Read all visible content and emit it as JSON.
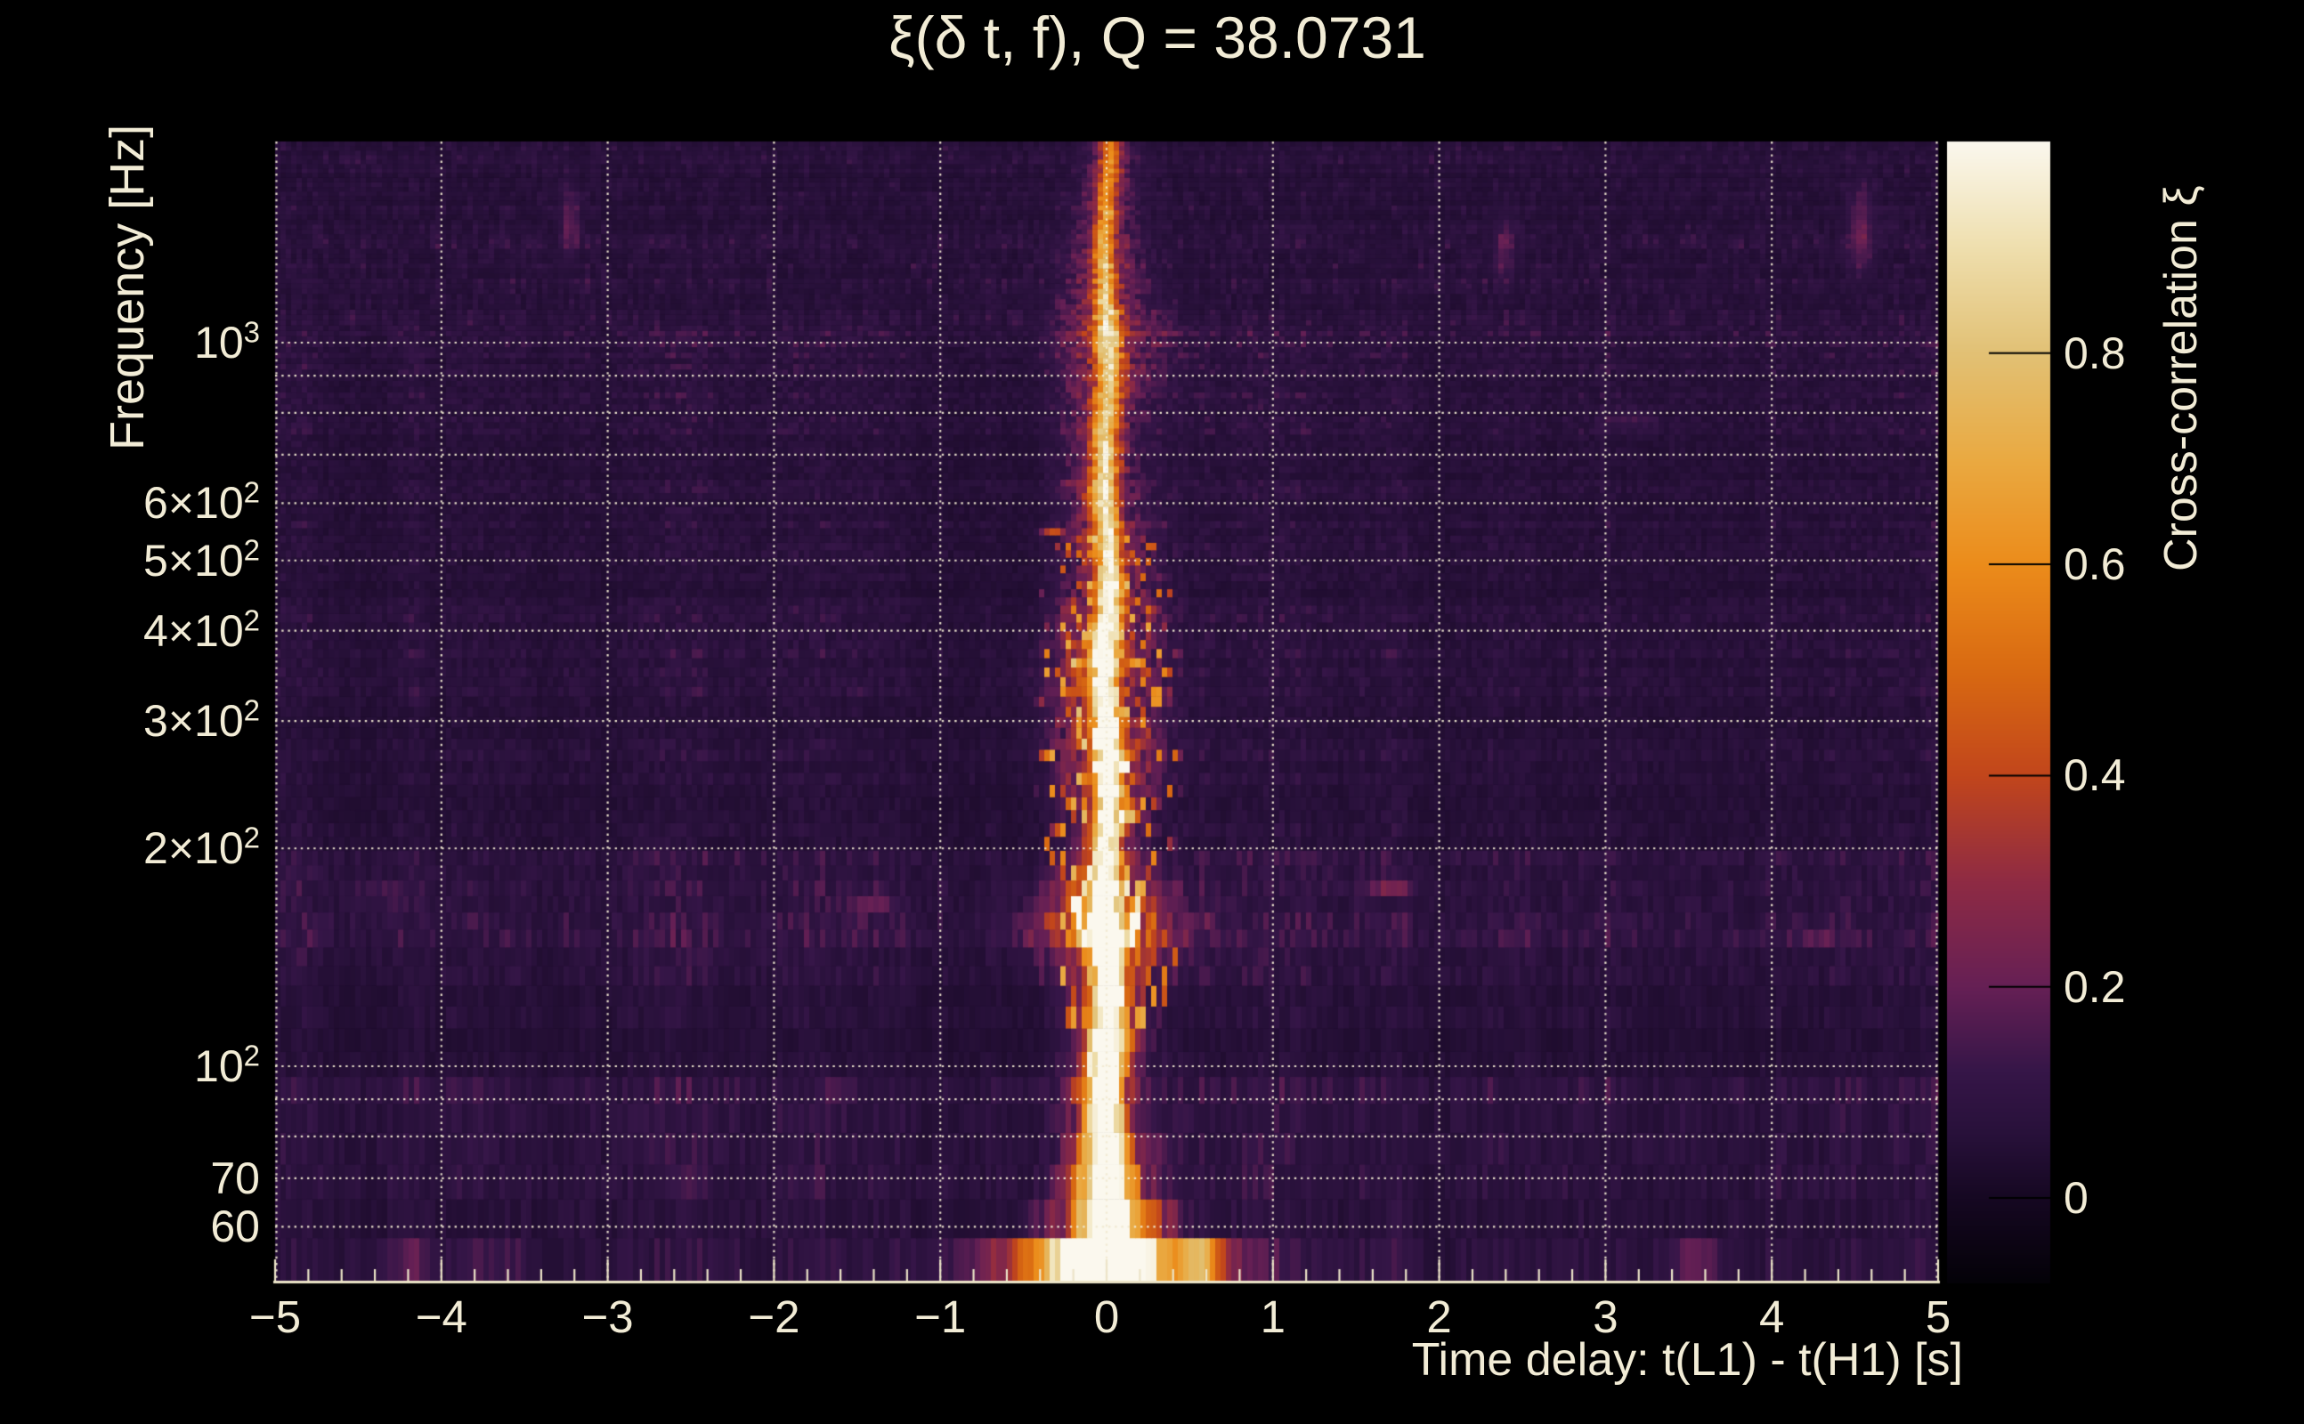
{
  "title": "ξ(δ t, f), Q = 38.0731",
  "chart_data": {
    "type": "heatmap",
    "title": "ξ(δ t, f), Q = 38.0731",
    "q_value": 38.0731,
    "xlabel": "Time delay: t(L1) - t(H1) [s]",
    "ylabel": "Frequency [Hz]",
    "colorbar_label": "Cross-correlation ξ",
    "x_range": [
      -5,
      5
    ],
    "x_minor_step": 0.2,
    "x_ticks": [
      {
        "label": "−5",
        "value": -5
      },
      {
        "label": "−4",
        "value": -4
      },
      {
        "label": "−3",
        "value": -3
      },
      {
        "label": "−2",
        "value": -2
      },
      {
        "label": "−1",
        "value": -1
      },
      {
        "label": "0",
        "value": 0
      },
      {
        "label": "1",
        "value": 1
      },
      {
        "label": "2",
        "value": 2
      },
      {
        "label": "3",
        "value": 3
      },
      {
        "label": "4",
        "value": 4
      },
      {
        "label": "5",
        "value": 5
      }
    ],
    "y_scale": "log",
    "y_range_hz": [
      50.4,
      1897
    ],
    "y_ticks": [
      {
        "base": "10",
        "exp": "3",
        "hz": 1000
      },
      {
        "base": "6×10",
        "exp": "2",
        "hz": 600
      },
      {
        "base": "5×10",
        "exp": "2",
        "hz": 500
      },
      {
        "base": "4×10",
        "exp": "2",
        "hz": 400
      },
      {
        "base": "3×10",
        "exp": "2",
        "hz": 300
      },
      {
        "base": "2×10",
        "exp": "2",
        "hz": 200
      },
      {
        "base": "10",
        "exp": "2",
        "hz": 100
      },
      {
        "base": "70",
        "exp": "",
        "hz": 70
      },
      {
        "base": "60",
        "exp": "",
        "hz": 60
      }
    ],
    "y_gridlines_hz": [
      60,
      70,
      80,
      90,
      100,
      200,
      300,
      400,
      500,
      600,
      700,
      800,
      900,
      1000
    ],
    "grid": true,
    "z_range": [
      -0.08,
      1.0
    ],
    "colorbar_position": "right",
    "colorbar_ticks": [
      {
        "label": "0.8",
        "value": 0.8
      },
      {
        "label": "0.6",
        "value": 0.6
      },
      {
        "label": "0.4",
        "value": 0.4
      },
      {
        "label": "0.2",
        "value": 0.2
      },
      {
        "label": "0",
        "value": 0
      }
    ],
    "colormap_stops": [
      [
        -0.08,
        4,
        2,
        8
      ],
      [
        0.0,
        22,
        8,
        34
      ],
      [
        0.06,
        40,
        17,
        58
      ],
      [
        0.12,
        54,
        22,
        72
      ],
      [
        0.2,
        102,
        32,
        85
      ],
      [
        0.3,
        143,
        43,
        68
      ],
      [
        0.4,
        194,
        70,
        28
      ],
      [
        0.5,
        217,
        106,
        18
      ],
      [
        0.6,
        236,
        140,
        27
      ],
      [
        0.7,
        234,
        170,
        66
      ],
      [
        0.8,
        226,
        193,
        117
      ],
      [
        0.9,
        239,
        223,
        174
      ],
      [
        1.0,
        251,
        248,
        238
      ]
    ],
    "main_feature": "bright cross-correlation ridge at time delay ≈ 0 s spanning 50–1900 Hz, strongest (ξ→1) below ~200 Hz with a white maximum near 55–60 Hz and ~100 Hz",
    "ridge_center_s": 0,
    "ridge_profile": [
      {
        "f": 50,
        "core": 1.02,
        "cw": 14,
        "glow": 0.95,
        "gw": 60
      },
      {
        "f": 57,
        "core": 1.03,
        "cw": 16,
        "glow": 0.9,
        "gw": 75
      },
      {
        "f": 66,
        "core": 1.0,
        "cw": 12,
        "glow": 0.75,
        "gw": 48
      },
      {
        "f": 78,
        "core": 1.0,
        "cw": 10,
        "glow": 0.6,
        "gw": 38
      },
      {
        "f": 92,
        "core": 0.95,
        "cw": 9,
        "glow": 0.55,
        "gw": 34
      },
      {
        "f": 103,
        "core": 1.0,
        "cw": 10,
        "glow": 0.65,
        "gw": 40
      },
      {
        "f": 118,
        "core": 0.92,
        "cw": 9,
        "glow": 0.5,
        "gw": 34
      },
      {
        "f": 135,
        "core": 0.9,
        "cw": 9,
        "glow": 0.55,
        "gw": 46
      },
      {
        "f": 152,
        "core": 0.93,
        "cw": 10,
        "glow": 0.68,
        "gw": 78
      },
      {
        "f": 168,
        "core": 0.92,
        "cw": 9,
        "glow": 0.62,
        "gw": 66
      },
      {
        "f": 188,
        "core": 0.86,
        "cw": 8,
        "glow": 0.5,
        "gw": 42
      },
      {
        "f": 210,
        "core": 0.82,
        "cw": 8,
        "glow": 0.45,
        "gw": 34
      },
      {
        "f": 240,
        "core": 0.82,
        "cw": 8,
        "glow": 0.5,
        "gw": 46
      },
      {
        "f": 275,
        "core": 0.85,
        "cw": 8,
        "glow": 0.52,
        "gw": 56
      },
      {
        "f": 310,
        "core": 0.8,
        "cw": 8,
        "glow": 0.48,
        "gw": 52
      },
      {
        "f": 350,
        "core": 0.82,
        "cw": 8,
        "glow": 0.5,
        "gw": 56
      },
      {
        "f": 400,
        "core": 0.84,
        "cw": 8,
        "glow": 0.46,
        "gw": 50
      },
      {
        "f": 460,
        "core": 0.76,
        "cw": 7,
        "glow": 0.4,
        "gw": 44
      },
      {
        "f": 530,
        "core": 0.7,
        "cw": 7,
        "glow": 0.36,
        "gw": 40
      },
      {
        "f": 620,
        "core": 0.7,
        "cw": 7,
        "glow": 0.34,
        "gw": 44
      },
      {
        "f": 720,
        "core": 0.66,
        "cw": 7,
        "glow": 0.3,
        "gw": 40
      },
      {
        "f": 830,
        "core": 0.62,
        "cw": 7,
        "glow": 0.3,
        "gw": 44
      },
      {
        "f": 950,
        "core": 0.62,
        "cw": 7,
        "glow": 0.34,
        "gw": 50
      },
      {
        "f": 1050,
        "core": 0.66,
        "cw": 7,
        "glow": 0.38,
        "gw": 54
      },
      {
        "f": 1200,
        "core": 0.56,
        "cw": 6,
        "glow": 0.3,
        "gw": 44
      },
      {
        "f": 1400,
        "core": 0.5,
        "cw": 6,
        "glow": 0.24,
        "gw": 38
      },
      {
        "f": 1600,
        "core": 0.45,
        "cw": 6,
        "glow": 0.2,
        "gw": 34
      },
      {
        "f": 1900,
        "core": 0.4,
        "cw": 6,
        "glow": 0.16,
        "gw": 30
      }
    ],
    "noise_bands": [
      [
        50,
        58,
        0.95
      ],
      [
        58,
        72,
        1.15
      ],
      [
        72,
        95,
        1.25
      ],
      [
        95,
        116,
        0.8
      ],
      [
        116,
        142,
        1.0
      ],
      [
        142,
        200,
        1.35
      ],
      [
        200,
        262,
        0.85
      ],
      [
        262,
        430,
        0.95
      ],
      [
        430,
        530,
        0.8
      ],
      [
        530,
        700,
        0.9
      ],
      [
        700,
        950,
        1.05
      ],
      [
        950,
        1060,
        1.35
      ],
      [
        1060,
        1400,
        1.05
      ],
      [
        1400,
        1897,
        0.95
      ]
    ],
    "noise_blobs": [
      {
        "x": 560,
        "y": 1427,
        "a": 0.3,
        "sx": 34,
        "sy": 9
      },
      {
        "x": 640,
        "y": 1436,
        "a": 0.22,
        "sx": 26,
        "sy": 7
      },
      {
        "x": 455,
        "y": 1421,
        "a": 0.13,
        "sx": 30,
        "sy": 9
      },
      {
        "x": 352,
        "y": 1432,
        "a": 0.1,
        "sx": 40,
        "sy": 8
      },
      {
        "x": 1348,
        "y": 1420,
        "a": 0.45,
        "sx": 26,
        "sy": 11
      },
      {
        "x": 1170,
        "y": 1398,
        "a": 0.22,
        "sx": 30,
        "sy": 10
      },
      {
        "x": 1905,
        "y": 1408,
        "a": 0.26,
        "sx": 28,
        "sy": 9
      },
      {
        "x": 2090,
        "y": 255,
        "a": 0.14,
        "sx": 14,
        "sy": 45
      },
      {
        "x": 640,
        "y": 250,
        "a": 0.12,
        "sx": 10,
        "sy": 40
      },
      {
        "x": 1690,
        "y": 280,
        "a": 0.11,
        "sx": 12,
        "sy": 38
      },
      {
        "x": 980,
        "y": 1015,
        "a": 0.13,
        "sx": 30,
        "sy": 12
      },
      {
        "x": 1560,
        "y": 995,
        "a": 0.12,
        "sx": 28,
        "sy": 11
      },
      {
        "x": 430,
        "y": 1005,
        "a": 0.11,
        "sx": 30,
        "sy": 11
      },
      {
        "x": 2040,
        "y": 1050,
        "a": 0.1,
        "sx": 26,
        "sy": 11
      },
      {
        "x": 760,
        "y": 1340,
        "a": 0.12,
        "sx": 26,
        "sy": 9
      },
      {
        "x": 1830,
        "y": 470,
        "a": 0.08,
        "sx": 30,
        "sy": 10
      }
    ]
  },
  "colors": {
    "background": "#000000",
    "text_cream": "#f2ecd6",
    "axis_line": "#ece4c8",
    "gridline": "#f1ead2",
    "colorbar_tick": "#000000"
  }
}
